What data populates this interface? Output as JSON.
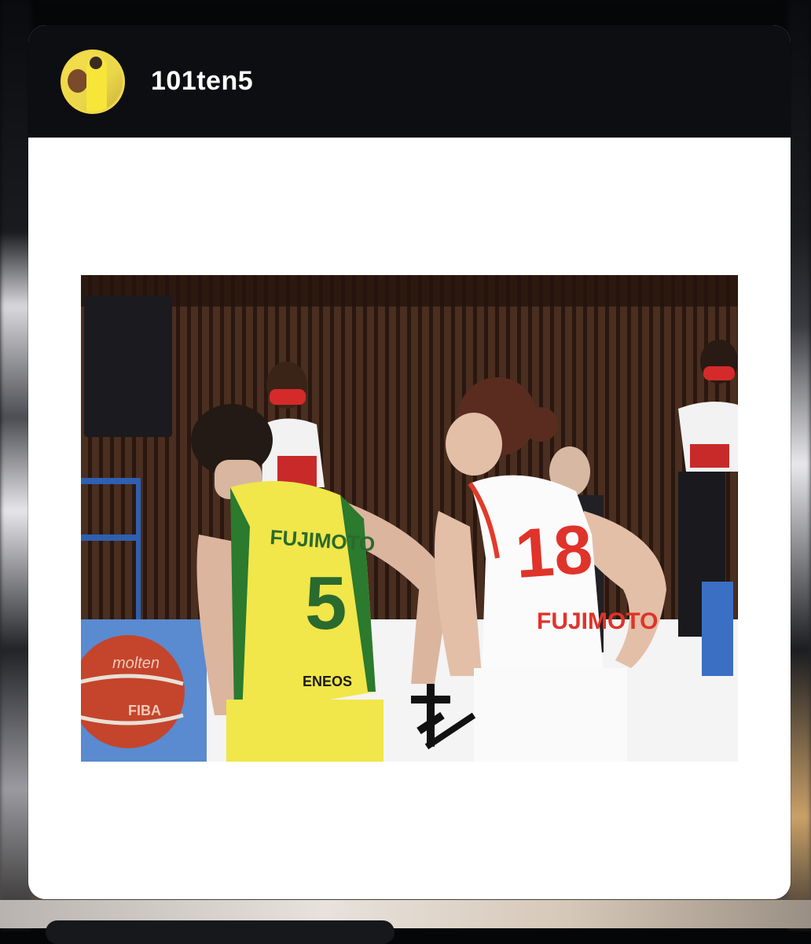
{
  "post": {
    "username": "101ten5"
  },
  "photo": {
    "left_player": {
      "name": "FUJIMOTO",
      "number": "5",
      "sponsor": "ENEOS"
    },
    "right_player": {
      "name": "FUJIMOTO",
      "number": "18"
    },
    "ball_text": "molten",
    "ball_mark": "FIBA"
  }
}
